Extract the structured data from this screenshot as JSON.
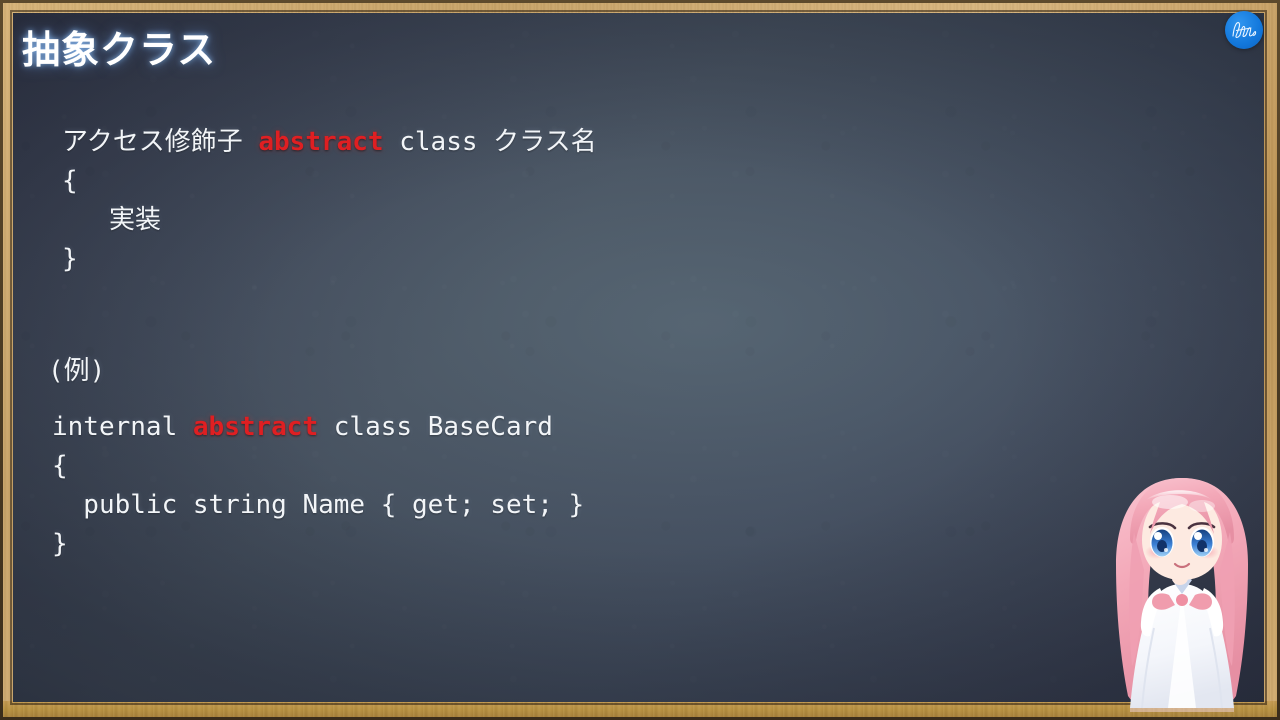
{
  "slide": {
    "title": "抽象クラス",
    "accent_red": "#df1f22",
    "board_color": "#47525f",
    "frame_color": "#c9a468",
    "text_color": "#f2f5f8"
  },
  "syntax_block": {
    "line1_prefix": "アクセス修飾子 ",
    "line1_keyword": "abstract",
    "line1_suffix": " class クラス名",
    "line2": "{",
    "line3": "   実装",
    "line4": "}"
  },
  "example": {
    "label": "(例)",
    "line1_prefix": "internal ",
    "line1_keyword": "abstract",
    "line1_suffix": " class BaseCard",
    "line2": "{",
    "line3": "  public string Name { get; set; }",
    "line4": "}"
  },
  "logo": {
    "name": "channel-logo",
    "shape": "blue-circle-signature",
    "background": "#1277db"
  },
  "character": {
    "name": "chibi-mascot",
    "hair_color": "#f3a8b8",
    "eye_color": "#3b7fd4",
    "dress_color": "#f7f8fb",
    "bow_color": "#f09cad"
  }
}
